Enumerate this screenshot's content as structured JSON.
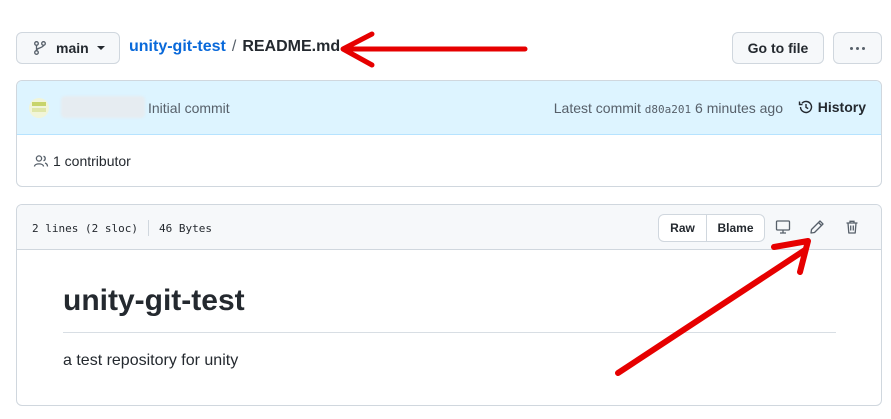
{
  "header": {
    "branch_label": "main",
    "repo_name": "unity-git-test",
    "separator": "/",
    "file_name": "README.md",
    "go_to_file_label": "Go to file"
  },
  "commit": {
    "message": "Initial commit",
    "latest_prefix": "Latest commit",
    "sha": "d80a201",
    "time_ago": "6 minutes ago",
    "history_label": "History",
    "contributors_label": "1 contributor"
  },
  "file": {
    "lines_info": "2 lines (2 sloc)",
    "size_info": "46 Bytes",
    "raw_label": "Raw",
    "blame_label": "Blame",
    "icons": [
      "desktop-icon",
      "pencil-icon",
      "trash-icon"
    ]
  },
  "content": {
    "heading": "unity-git-test",
    "paragraph": "a test repository for unity"
  },
  "colors": {
    "link": "#0969da",
    "commit_bg": "#ddf4ff",
    "annotation_arrow": "#e60000"
  }
}
